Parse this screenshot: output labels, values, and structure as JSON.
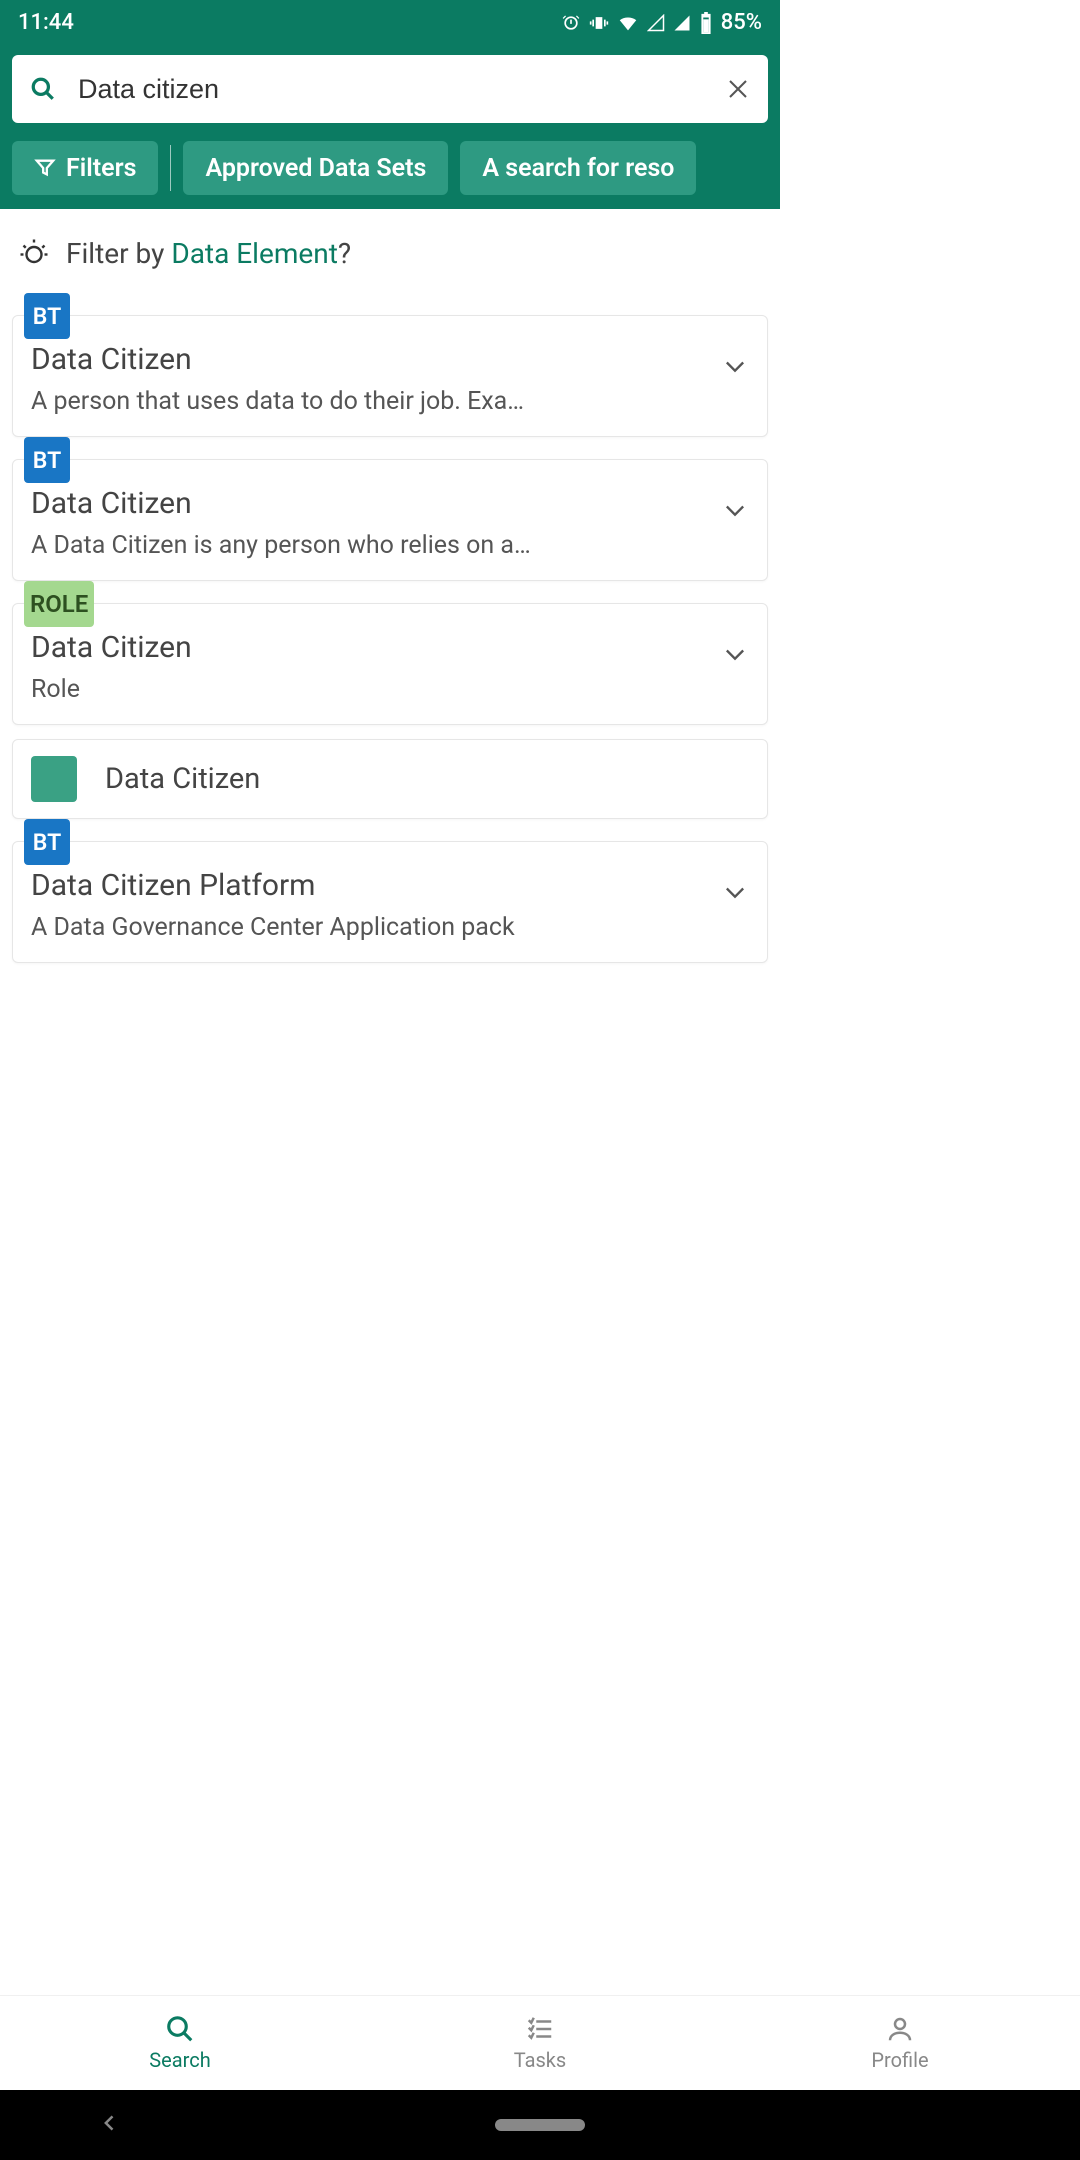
{
  "status": {
    "time": "11:44",
    "battery": "85%"
  },
  "search": {
    "value": "Data citizen"
  },
  "chips": {
    "filters": "Filters",
    "c1": "Approved Data Sets",
    "c2": "A search for reso"
  },
  "suggest": {
    "prefix": "Filter by ",
    "link": "Data Element",
    "suffix": "?"
  },
  "results": [
    {
      "badge": "BT",
      "badgeClass": "bt",
      "title": "Data Citizen",
      "desc": "A person that uses data to do their job. Exa…"
    },
    {
      "badge": "BT",
      "badgeClass": "bt",
      "title": "Data Citizen",
      "desc": "A Data Citizen is any person who relies on a…"
    },
    {
      "badge": "ROLE",
      "badgeClass": "role",
      "title": "Data Citizen",
      "desc": "Role"
    }
  ],
  "simple": {
    "title": "Data Citizen"
  },
  "result5": {
    "badge": "BT",
    "title": "Data Citizen Platform",
    "desc": "A Data Governance Center Application pack"
  },
  "nav": {
    "search": "Search",
    "tasks": "Tasks",
    "profile": "Profile"
  }
}
